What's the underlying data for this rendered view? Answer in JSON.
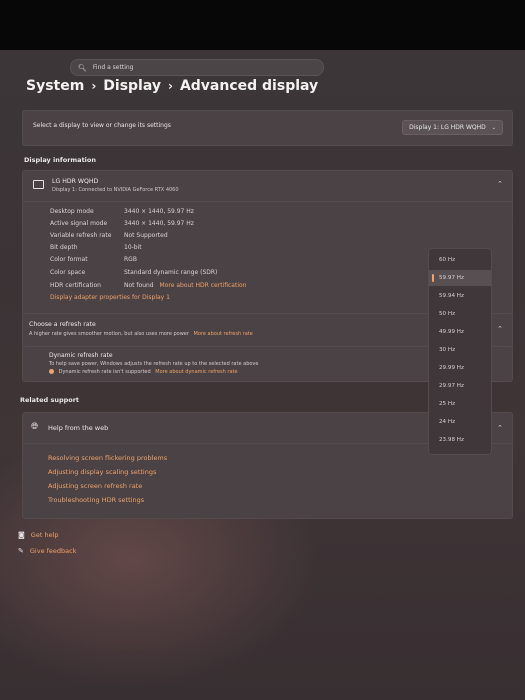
{
  "search": {
    "placeholder": "Find a setting"
  },
  "breadcrumb": {
    "items": [
      "System",
      "Display",
      "Advanced display"
    ],
    "sep": "›"
  },
  "select_display": {
    "label": "Select a display to view or change its settings",
    "value": "Display 1: LG HDR WQHD"
  },
  "display_info": {
    "title": "Display information",
    "monitor_name": "LG HDR WQHD",
    "monitor_sub": "Display 1: Connected to NVIDIA GeForce RTX 4060",
    "rows": [
      {
        "label": "Desktop mode",
        "value": "3440 × 1440, 59.97 Hz"
      },
      {
        "label": "Active signal mode",
        "value": "3440 × 1440, 59.97 Hz"
      },
      {
        "label": "Variable refresh rate",
        "value": "Not Supported"
      },
      {
        "label": "Bit depth",
        "value": "10-bit"
      },
      {
        "label": "Color format",
        "value": "RGB"
      },
      {
        "label": "Color space",
        "value": "Standard dynamic range (SDR)"
      },
      {
        "label": "HDR certification",
        "value": "Not found",
        "link": "More about HDR certification"
      }
    ],
    "adapter_link": "Display adapter properties for Display 1"
  },
  "refresh": {
    "title": "Choose a refresh rate",
    "desc": "A higher rate gives smoother motion, but also uses more power",
    "link": "More about refresh rate",
    "options": [
      "60 Hz",
      "59.97 Hz",
      "59.94 Hz",
      "50 Hz",
      "49.99 Hz",
      "30 Hz",
      "29.99 Hz",
      "29.97 Hz",
      "25 Hz",
      "24 Hz",
      "23.98 Hz"
    ],
    "selected": "59.97 Hz"
  },
  "dynamic": {
    "title": "Dynamic refresh rate",
    "desc": "To help save power, Windows adjusts the refresh rate up to the selected rate above",
    "warning": "Dynamic refresh rate isn't supported",
    "link": "More about dynamic refresh rate"
  },
  "related": {
    "title": "Related support",
    "help_title": "Help from the web",
    "links": [
      "Resolving screen flickering problems",
      "Adjusting display scaling settings",
      "Adjusting screen refresh rate",
      "Troubleshooting HDR settings"
    ]
  },
  "footer": {
    "get_help": "Get help",
    "give_feedback": "Give feedback"
  },
  "colors": {
    "accent": "#f0a36a",
    "card": "#4a4245",
    "background": "#3d3638"
  }
}
